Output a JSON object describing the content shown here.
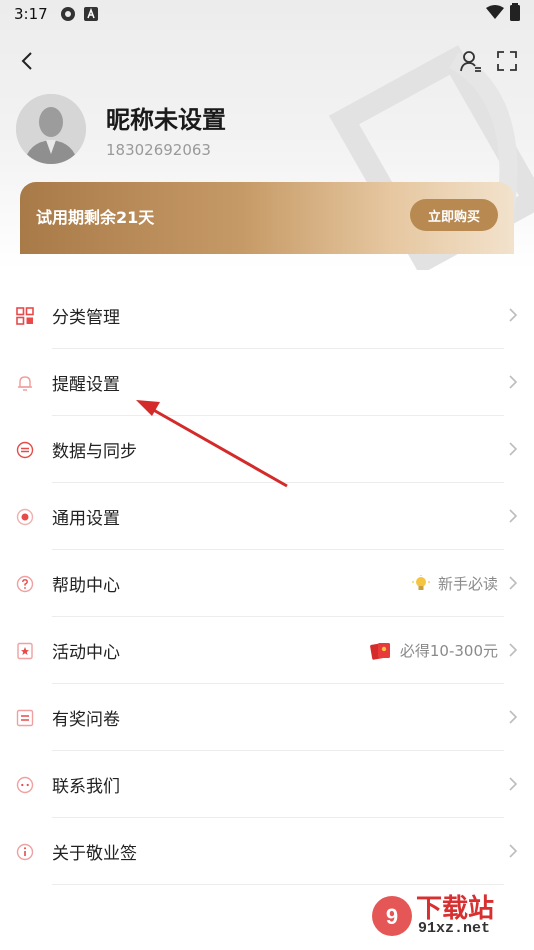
{
  "status_bar": {
    "time": "3:17"
  },
  "profile": {
    "nickname": "昵称未设置",
    "phone": "18302692063"
  },
  "trial": {
    "text": "试用期剩余21天",
    "buy_label": "立即购买"
  },
  "menu": {
    "items": [
      {
        "label": "分类管理",
        "icon": "category-icon"
      },
      {
        "label": "提醒设置",
        "icon": "bell-icon"
      },
      {
        "label": "数据与同步",
        "icon": "sync-icon"
      },
      {
        "label": "通用设置",
        "icon": "settings-icon"
      },
      {
        "label": "帮助中心",
        "icon": "help-icon",
        "extra": "新手必读",
        "extra_icon": "bulb-icon"
      },
      {
        "label": "活动中心",
        "icon": "activity-icon",
        "extra": "必得10-300元",
        "extra_icon": "red-envelope-icon"
      },
      {
        "label": "有奖问卷",
        "icon": "survey-icon"
      },
      {
        "label": "联系我们",
        "icon": "contact-icon"
      },
      {
        "label": "关于敬业签",
        "icon": "info-icon"
      }
    ]
  },
  "watermark": {
    "line1": "下载站",
    "line2": "91xz.net"
  },
  "colors": {
    "accent": "#e84a4a",
    "gold": "#b88a52"
  }
}
